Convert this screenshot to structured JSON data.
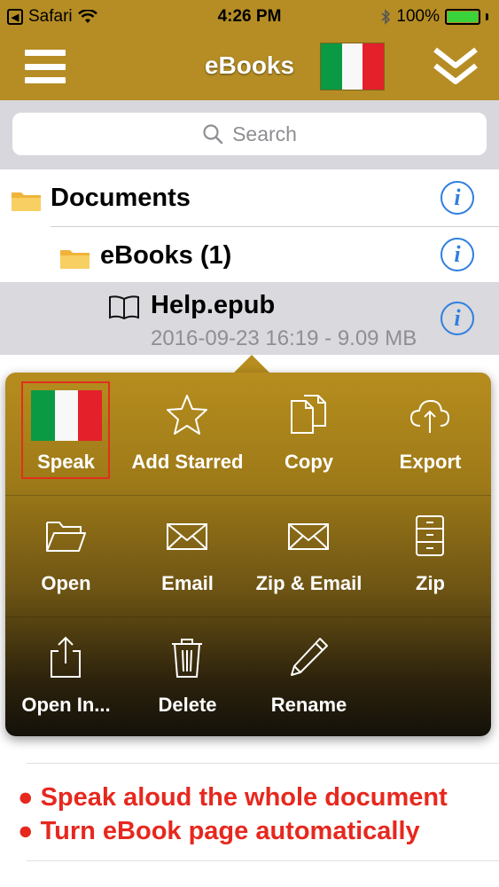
{
  "status": {
    "carrier": "Safari",
    "time": "4:26 PM",
    "battery": "100%",
    "back_glyph": "◀"
  },
  "nav": {
    "title": "eBooks"
  },
  "search": {
    "placeholder": "Search"
  },
  "list": {
    "documents": "Documents",
    "ebooks_folder": "eBooks (1)",
    "file_name": "Help.epub",
    "file_meta": "2016-09-23 16:19 - 9.09 MB"
  },
  "menu": {
    "speak": "Speak",
    "add_starred": "Add Starred",
    "copy": "Copy",
    "export": "Export",
    "open": "Open",
    "email": "Email",
    "zip_email": "Zip & Email",
    "zip": "Zip",
    "open_in": "Open In...",
    "delete": "Delete",
    "rename": "Rename"
  },
  "promo": {
    "line1": "● Speak aloud the whole document",
    "line2": "● Turn eBook page automatically"
  },
  "colors": {
    "brand": "#b58d24",
    "accent": "#2f7fe0",
    "promo": "#e6281e",
    "battery": "#39d23b"
  }
}
